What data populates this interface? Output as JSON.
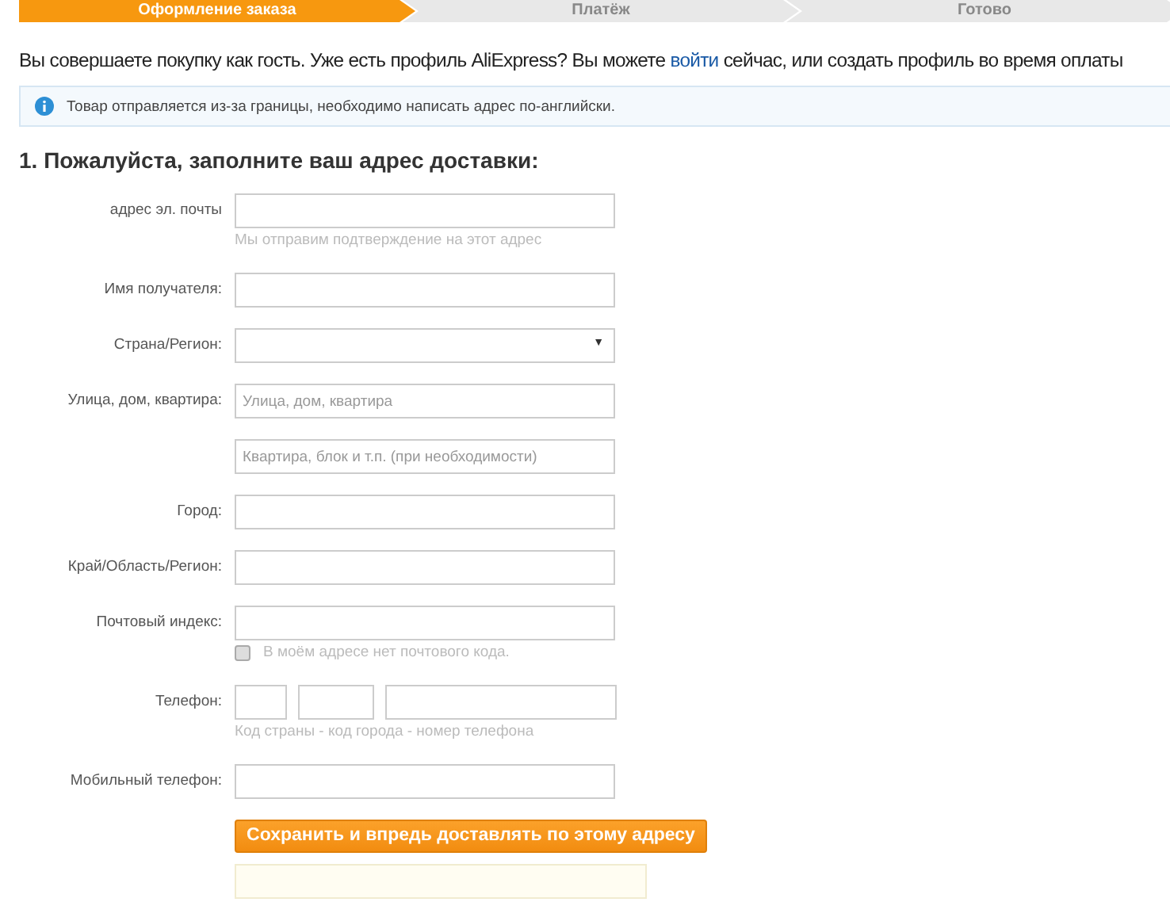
{
  "steps": [
    {
      "label": "Оформление заказа",
      "selected": true
    },
    {
      "label": "Платёж",
      "selected": false
    },
    {
      "label": "Готово",
      "selected": false
    }
  ],
  "intro": {
    "before": "Вы совершаете покупку как гость. Уже есть профиль AliExpress? Вы можете",
    "link": "войти",
    "after": "сейчас, или создать профиль во время оплаты"
  },
  "notice": "Товар отправляется из-за границы, необходимо написать адрес по-английски.",
  "heading": "1. Пожалуйста, заполните ваш адрес доставки:",
  "fields": [
    {
      "kind": "text",
      "label": "адрес эл. почты",
      "hint": "Мы отправим подтверждение на этот адрес"
    },
    {
      "kind": "text",
      "label": "Имя получателя:"
    },
    {
      "kind": "select",
      "label": "Страна/Регион:",
      "arrow": "▼"
    },
    {
      "kind": "text",
      "label": "Улица, дом, квартира:",
      "placeholder": "Улица, дом, квартира"
    },
    {
      "kind": "text",
      "placeholder": "Квартира, блок и т.п. (при необходимости)"
    },
    {
      "kind": "text",
      "label": "Город:"
    },
    {
      "kind": "text",
      "label": "Край/Область/Регион:"
    },
    {
      "kind": "text",
      "label": "Почтовый индекс:",
      "checkbox": {
        "label": "В моём адресе нет почтового кода.",
        "checked": false
      }
    },
    {
      "kind": "phone",
      "label": "Телефон:",
      "hint": "Код страны - код города - номер телефона"
    },
    {
      "kind": "text",
      "label": "Мобильный телефон:"
    }
  ],
  "submit": "Сохранить и впредь доставлять по этому адресу"
}
